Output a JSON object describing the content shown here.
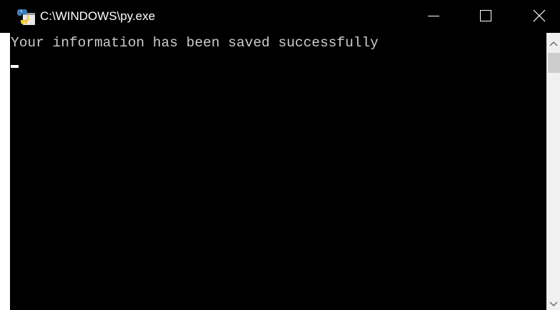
{
  "window": {
    "title": "C:\\WINDOWS\\py.exe",
    "app_icon": "python-icon",
    "controls": {
      "minimize_icon": "minimize-icon",
      "maximize_icon": "maximize-icon",
      "close_icon": "close-icon"
    }
  },
  "console": {
    "lines": [
      "Your information has been saved successfully"
    ],
    "background_color": "#000000",
    "text_color": "#cccccc"
  },
  "scrollbar": {
    "up_icon": "scroll-up-arrow-icon",
    "down_icon": "scroll-down-arrow-icon"
  }
}
